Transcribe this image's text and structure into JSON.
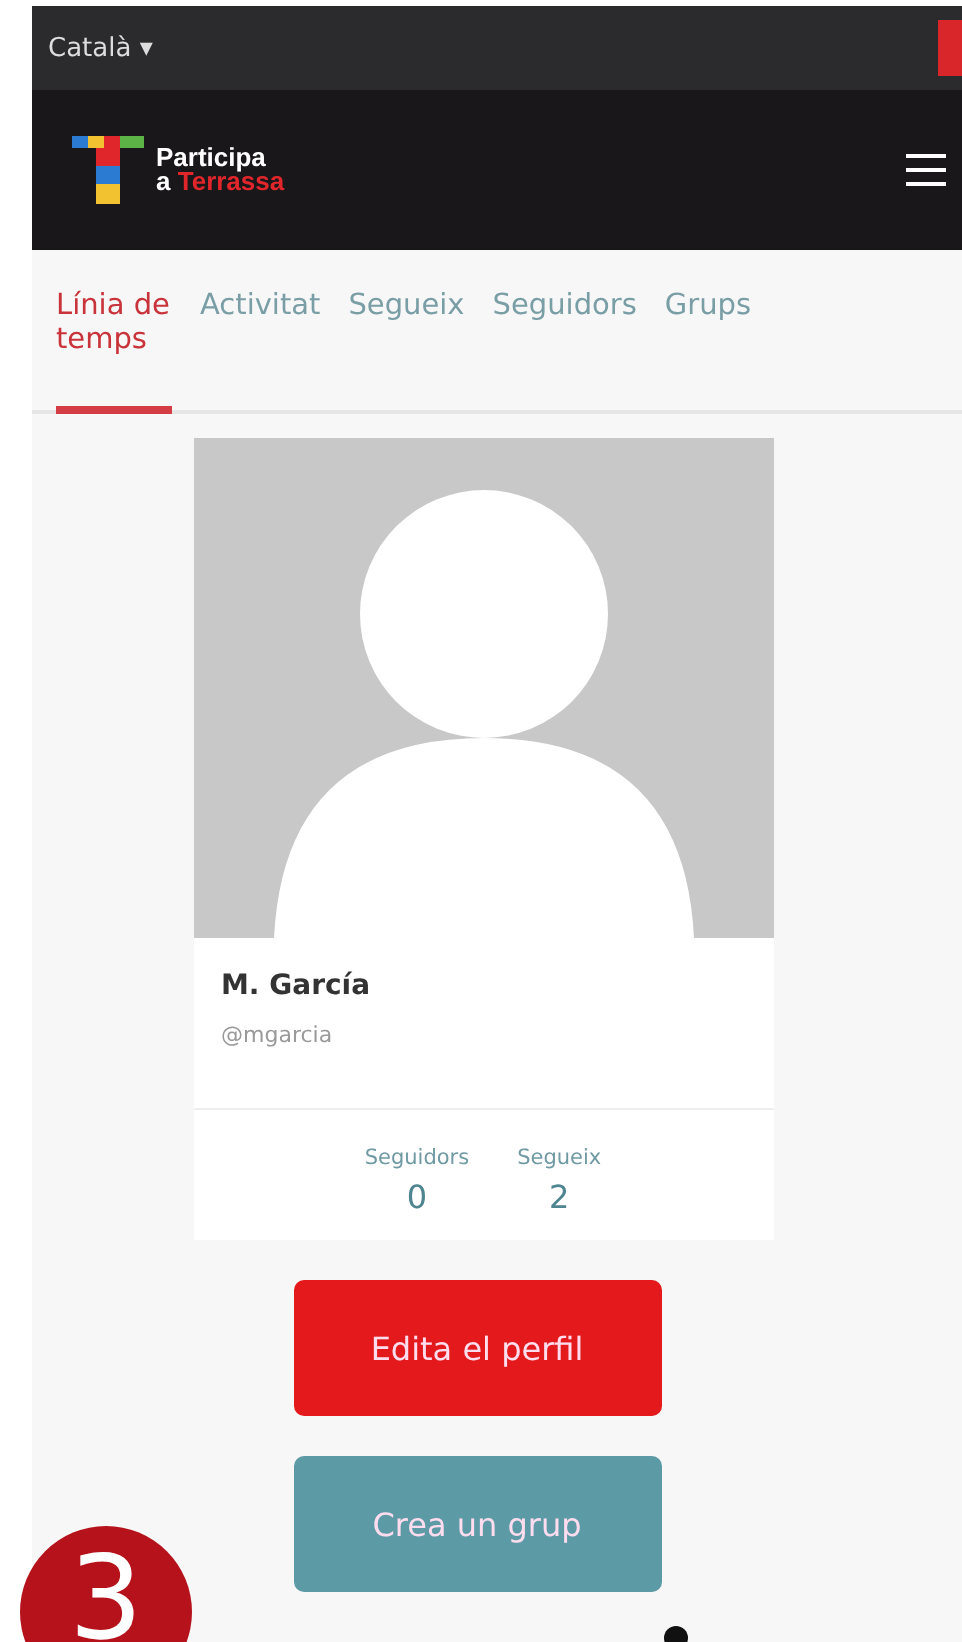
{
  "language_selector": {
    "label": "Català",
    "caret": "▾"
  },
  "logo": {
    "line_1": "Participa",
    "line_2_prefix": "a",
    "line_2_accent": "Terrassa"
  },
  "tabs": [
    {
      "label": "Línia de temps",
      "selected": true
    },
    {
      "label": "Activitat",
      "selected": false
    },
    {
      "label": "Segueix",
      "selected": false
    },
    {
      "label": "Seguidors",
      "selected": false
    },
    {
      "label": "Grups",
      "selected": false
    }
  ],
  "profile": {
    "name": "M. García",
    "handle": "@mgarcia",
    "stats": [
      {
        "label": "Seguidors",
        "value": "0"
      },
      {
        "label": "Segueix",
        "value": "2"
      }
    ]
  },
  "buttons": [
    {
      "label": "Edita el perfil",
      "kind": "primary"
    },
    {
      "label": "Crea un grup",
      "kind": "secondary"
    }
  ],
  "step_badge": "3"
}
